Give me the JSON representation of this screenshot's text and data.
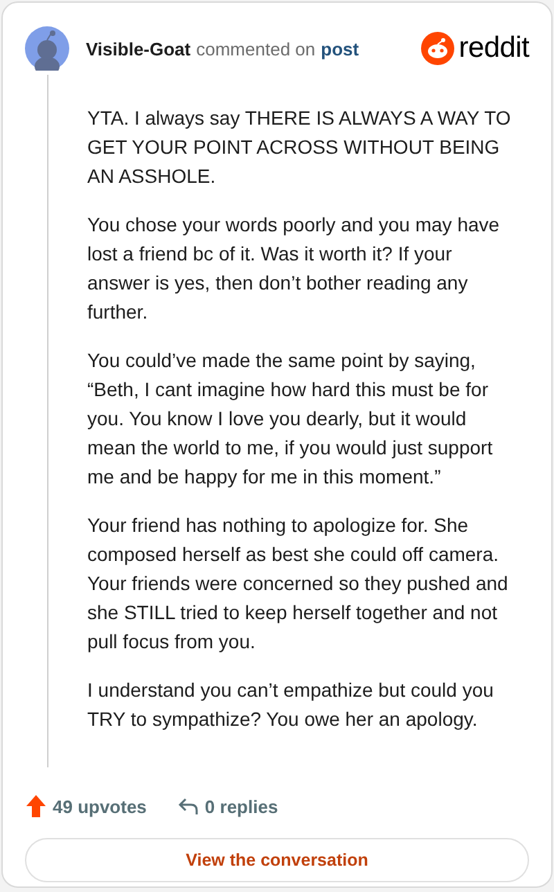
{
  "header": {
    "author": "Visible-Goat",
    "action": "commented on",
    "link": "post",
    "brand": "reddit"
  },
  "paragraphs": [
    "YTA. I always say THERE IS ALWAYS A WAY TO GET YOUR POINT ACROSS WITHOUT BEING AN ASSHOLE.",
    "You chose your words poorly and you may have lost a friend bc of it. Was it worth it? If your answer is yes, then don’t bother reading any further.",
    "You could’ve made the same point by saying, “Beth, I cant imagine how hard this must be for you. You know I love you dearly, but it would mean the world to me, if you would just support me and be happy for me in this moment.”",
    "Your friend has nothing to apologize for. She composed herself as best she could off camera. Your friends were concerned so they pushed and she STILL tried to keep herself together and not pull focus from you.",
    "I understand you can’t empathize but could you TRY to sympathize? You owe her an apology."
  ],
  "footer": {
    "upvotes": "49 upvotes",
    "replies": "0 replies",
    "button": "View the conversation"
  }
}
